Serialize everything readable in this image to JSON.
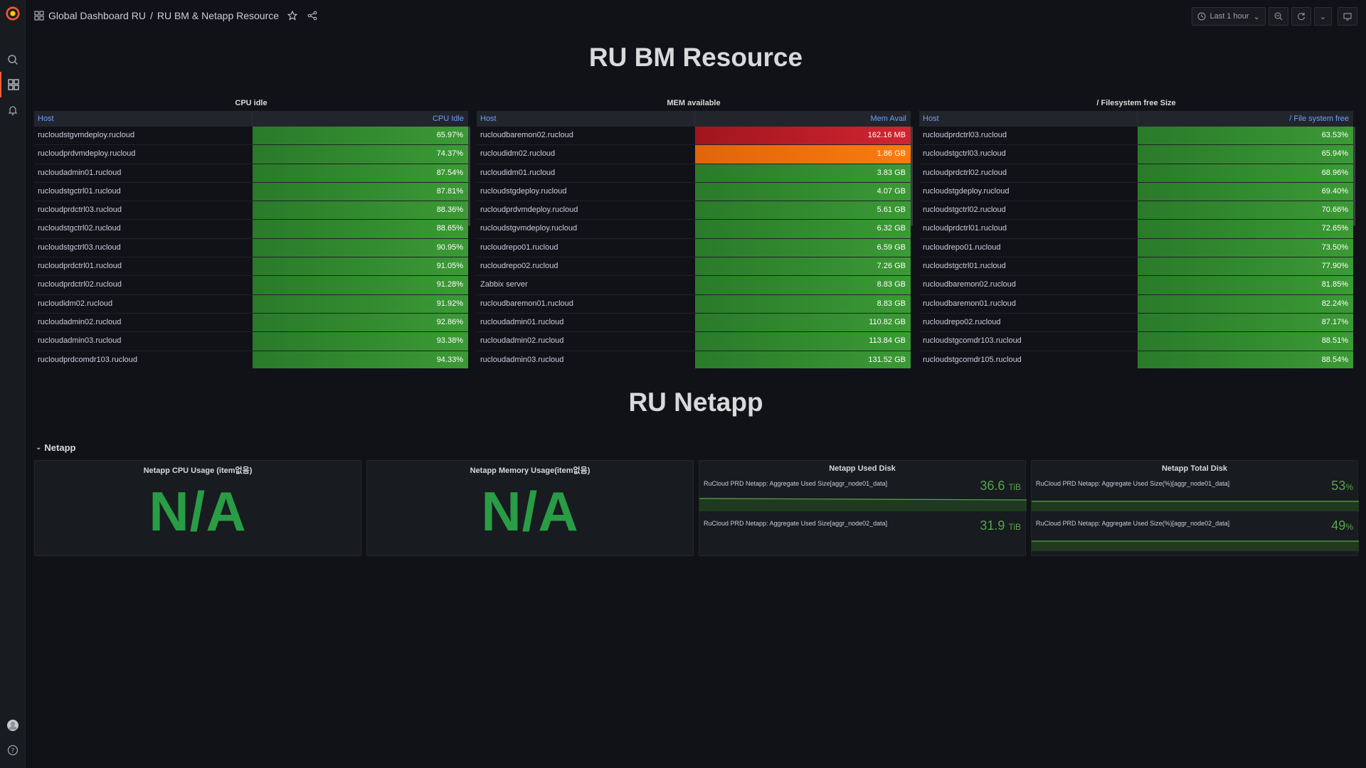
{
  "topbar": {
    "breadcrumb_folder": "Global Dashboard RU",
    "breadcrumb_sep": "/",
    "breadcrumb_dashboard": "RU BM & Netapp Resource",
    "time_range": "Last 1 hour"
  },
  "sections": {
    "bm_title": "RU BM Resource",
    "netapp_title": "RU Netapp",
    "netapp_row": "Netapp"
  },
  "cpu": {
    "title": "CPU idle",
    "col_host": "Host",
    "col_value": "CPU Idle",
    "rows": [
      {
        "host": "rucloudstgvmdeploy.rucloud",
        "value": "65.97%"
      },
      {
        "host": "rucloudprdvmdeploy.rucloud",
        "value": "74.37%"
      },
      {
        "host": "rucloudadmin01.rucloud",
        "value": "87.54%"
      },
      {
        "host": "rucloudstgctrl01.rucloud",
        "value": "87.81%"
      },
      {
        "host": "rucloudprdctrl03.rucloud",
        "value": "88.36%"
      },
      {
        "host": "rucloudstgctrl02.rucloud",
        "value": "88.65%"
      },
      {
        "host": "rucloudstgctrl03.rucloud",
        "value": "90.95%"
      },
      {
        "host": "rucloudprdctrl01.rucloud",
        "value": "91.05%"
      },
      {
        "host": "rucloudprdctrl02.rucloud",
        "value": "91.28%"
      },
      {
        "host": "rucloudidm02.rucloud",
        "value": "91.92%"
      },
      {
        "host": "rucloudadmin02.rucloud",
        "value": "92.86%"
      },
      {
        "host": "rucloudadmin03.rucloud",
        "value": "93.38%"
      },
      {
        "host": "rucloudprdcomdr103.rucloud",
        "value": "94.33%"
      }
    ]
  },
  "mem": {
    "title": "MEM available",
    "col_host": "Host",
    "col_value": "Mem Avail",
    "rows": [
      {
        "host": "rucloudbaremon02.rucloud",
        "value": "162.16 MB",
        "status": "red"
      },
      {
        "host": "rucloudidm02.rucloud",
        "value": "1.86 GB",
        "status": "orange"
      },
      {
        "host": "rucloudidm01.rucloud",
        "value": "3.83 GB",
        "status": "green"
      },
      {
        "host": "rucloudstgdeploy.rucloud",
        "value": "4.07 GB",
        "status": "green"
      },
      {
        "host": "rucloudprdvmdeploy.rucloud",
        "value": "5.61 GB",
        "status": "green"
      },
      {
        "host": "rucloudstgvmdeploy.rucloud",
        "value": "6.32 GB",
        "status": "green"
      },
      {
        "host": "rucloudrepo01.rucloud",
        "value": "6.59 GB",
        "status": "green"
      },
      {
        "host": "rucloudrepo02.rucloud",
        "value": "7.26 GB",
        "status": "green"
      },
      {
        "host": "Zabbix server",
        "value": "8.83 GB",
        "status": "green"
      },
      {
        "host": "rucloudbaremon01.rucloud",
        "value": "8.83 GB",
        "status": "green"
      },
      {
        "host": "rucloudadmin01.rucloud",
        "value": "110.82 GB",
        "status": "green"
      },
      {
        "host": "rucloudadmin02.rucloud",
        "value": "113.84 GB",
        "status": "green"
      },
      {
        "host": "rucloudadmin03.rucloud",
        "value": "131.52 GB",
        "status": "green"
      }
    ]
  },
  "fs": {
    "title": "/ Filesystem free Size",
    "col_host": "Host",
    "col_value": "/ File system free",
    "rows": [
      {
        "host": "rucloudprdctrl03.rucloud",
        "value": "63.53%"
      },
      {
        "host": "rucloudstgctrl03.rucloud",
        "value": "65.94%"
      },
      {
        "host": "rucloudprdctrl02.rucloud",
        "value": "68.96%"
      },
      {
        "host": "rucloudstgdeploy.rucloud",
        "value": "69.40%"
      },
      {
        "host": "rucloudstgctrl02.rucloud",
        "value": "70.66%"
      },
      {
        "host": "rucloudprdctrl01.rucloud",
        "value": "72.65%"
      },
      {
        "host": "rucloudrepo01.rucloud",
        "value": "73.50%"
      },
      {
        "host": "rucloudstgctrl01.rucloud",
        "value": "77.90%"
      },
      {
        "host": "rucloudbaremon02.rucloud",
        "value": "81.85%"
      },
      {
        "host": "rucloudbaremon01.rucloud",
        "value": "82.24%"
      },
      {
        "host": "rucloudrepo02.rucloud",
        "value": "87.17%"
      },
      {
        "host": "rucloudstgcomdr103.rucloud",
        "value": "88.51%"
      },
      {
        "host": "rucloudstgcomdr105.rucloud",
        "value": "88.54%"
      }
    ]
  },
  "netapp": {
    "cpu": {
      "title": "Netapp CPU Usage (item없음)",
      "value": "N/A"
    },
    "mem": {
      "title": "Netapp Memory Usage(item없음)",
      "value": "N/A"
    },
    "used_disk": {
      "title": "Netapp Used Disk",
      "items": [
        {
          "label": "RuCloud PRD Netapp: Aggregate Used Size[aggr_node01_data]",
          "value": "36.6",
          "unit": "TiB"
        },
        {
          "label": "RuCloud PRD Netapp: Aggregate Used Size[aggr_node02_data]",
          "value": "31.9",
          "unit": "TiB"
        }
      ]
    },
    "total_disk": {
      "title": "Netapp Total Disk",
      "items": [
        {
          "label": "RuCloud PRD Netapp: Aggregate Used Size(%)[aggr_node01_data]",
          "value": "53",
          "unit": "%"
        },
        {
          "label": "RuCloud PRD Netapp: Aggregate Used Size(%)[aggr_node02_data]",
          "value": "49",
          "unit": "%"
        }
      ]
    }
  },
  "colors": {
    "ok": "#3b9a35",
    "warn": "#fa7b10",
    "crit": "#d02531",
    "stat": "#299c46",
    "link": "#6e9fff"
  }
}
